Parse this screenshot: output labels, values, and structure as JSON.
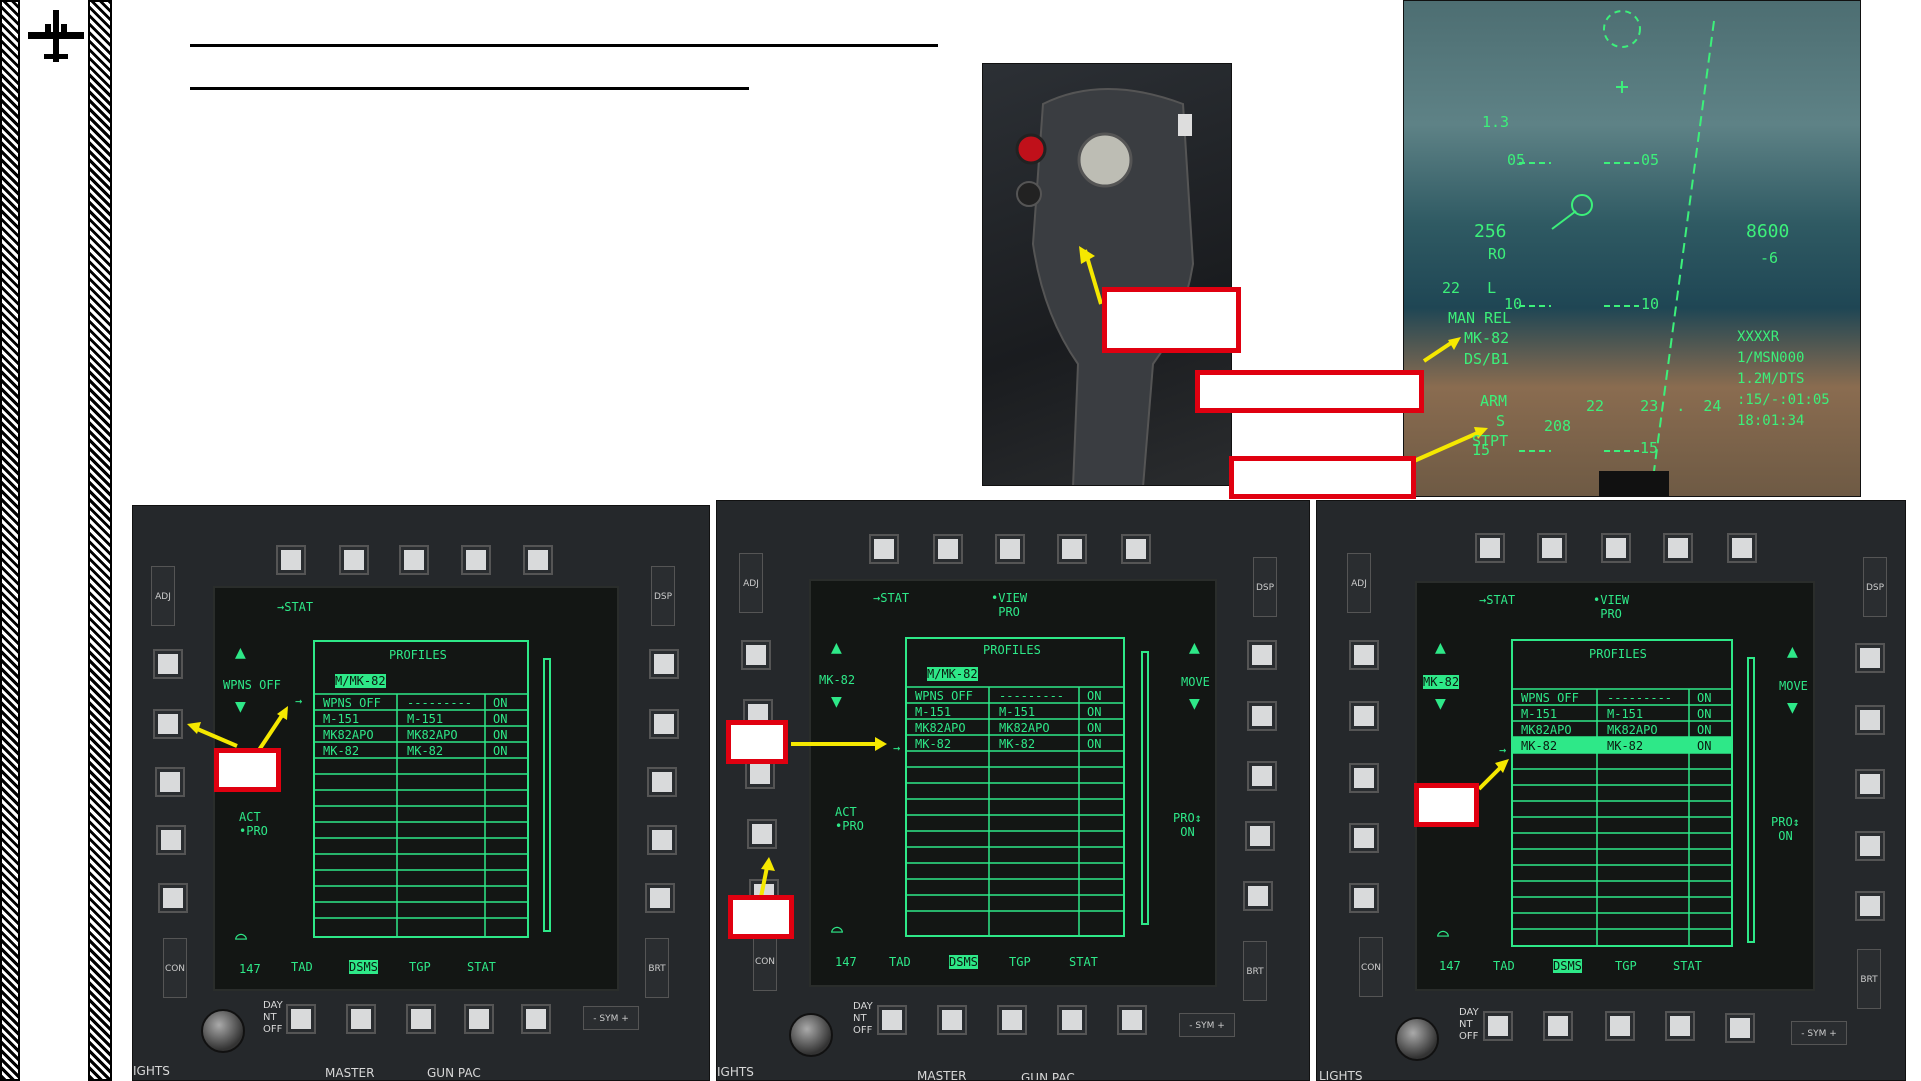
{
  "left_bar": {
    "logo_icon": "aircraft-silhouette-icon"
  },
  "hud": {
    "lines": [
      {
        "text": "1.3"
      },
      {
        "text": "05"
      },
      {
        "text": "05"
      },
      {
        "text": "256"
      },
      {
        "text": "RO"
      },
      {
        "text": "8600"
      },
      {
        "text": "-6"
      },
      {
        "text": "22   L"
      },
      {
        "text": "10"
      },
      {
        "text": "10"
      },
      {
        "text": "MAN REL"
      },
      {
        "text": "MK-82"
      },
      {
        "text": "DS/B1"
      },
      {
        "text": "ARM"
      },
      {
        "text": "S"
      },
      {
        "text": "STPT"
      },
      {
        "text": "22    23  .  24"
      },
      {
        "text": "208"
      },
      {
        "text": "15"
      },
      {
        "text": "15"
      },
      {
        "text": "XXXXR"
      },
      {
        "text": "1/MSN000"
      },
      {
        "text": "1.2M/DTS"
      },
      {
        "text": ":15/-:01:05"
      },
      {
        "text": "18:01:34"
      }
    ]
  },
  "mfcd_common": {
    "adj": "ADJ",
    "dsp": "DSP",
    "con": "CON",
    "brt": "BRT",
    "sym": "- SYM +",
    "day_nt_off": "DAY\nNT\nOFF",
    "stat": "→STAT",
    "profiles": "PROFILES",
    "view_pro": "•VIEW\n PRO",
    "act_pro": "ACT\n•PRO",
    "pro_on": "PRO↕\n ON",
    "move": "MOVE",
    "bottom_tabs": [
      "147",
      "TAD",
      "DSMS",
      "TGP",
      "STAT"
    ],
    "rows": [
      [
        "WPNS OFF",
        "---------",
        "ON"
      ],
      [
        "M-151",
        "M-151",
        "ON"
      ],
      [
        "MK82APO",
        "MK82APO",
        "ON"
      ],
      [
        "MK-82",
        "MK-82",
        "ON"
      ]
    ],
    "selected_profile": "M/MK-82"
  },
  "mfcd1": {
    "left_label": "WPNS OFF",
    "bottom_text": [
      "IGHTS",
      "MASTER",
      "GUN PAC"
    ]
  },
  "mfcd2": {
    "left_label": "MK-82",
    "bottom_text": [
      "IGHTS",
      "MASTER",
      "GUN PAC"
    ]
  },
  "mfcd3": {
    "left_label": "MK-82",
    "bottom_text": [
      "LIGHTS"
    ]
  }
}
